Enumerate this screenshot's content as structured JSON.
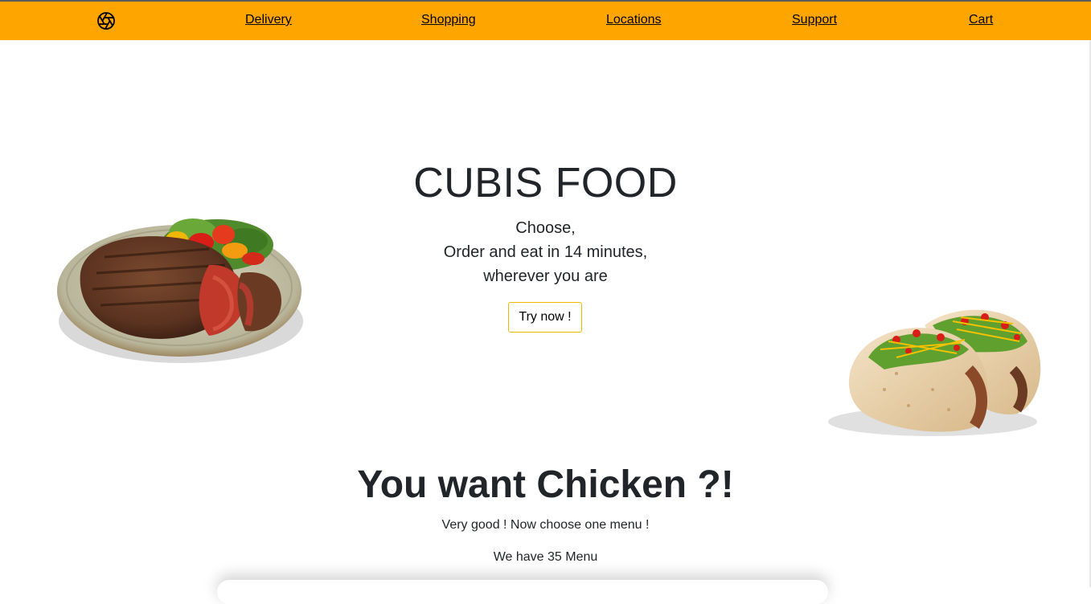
{
  "navbar": {
    "background": "#ffa500",
    "logo_icon": "aperture-icon",
    "links": [
      "Delivery",
      "Shopping",
      "Locations",
      "Support",
      "Cart"
    ]
  },
  "hero": {
    "title": "CUBIS FOOD",
    "lines": [
      "Choose,",
      "Order and eat in 14 minutes,",
      "wherever you are"
    ],
    "cta_label": "Try now !",
    "cta_border_color": "#f0b800",
    "images": [
      "steak-plate-image",
      "tacos-image"
    ]
  },
  "menu_section": {
    "title": "You want Chicken ?!",
    "subtitle": "Very good ! Now choose one menu !",
    "count_text": "We have 35 Menu"
  }
}
